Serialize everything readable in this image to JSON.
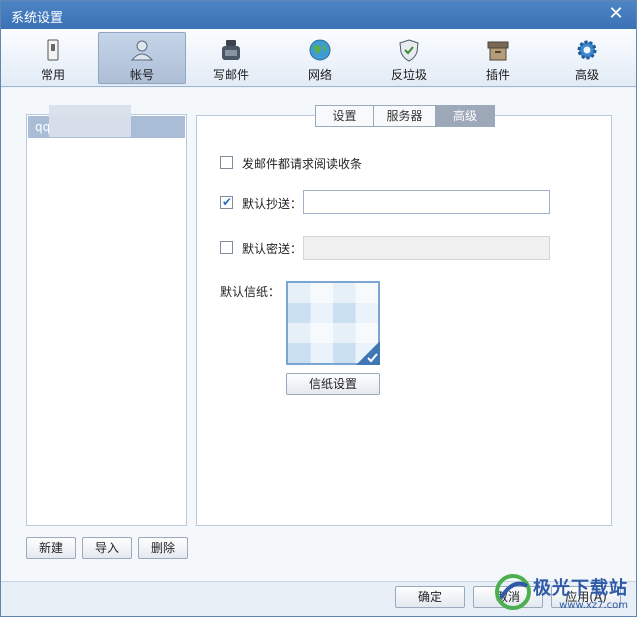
{
  "window": {
    "title": "系统设置"
  },
  "toolbar": {
    "items": [
      {
        "label": "常用",
        "icon": "phone-icon"
      },
      {
        "label": "帐号",
        "icon": "user-icon",
        "active": true
      },
      {
        "label": "写邮件",
        "icon": "ink-bottle-icon"
      },
      {
        "label": "网络",
        "icon": "globe-icon"
      },
      {
        "label": "反垃圾",
        "icon": "shield-icon"
      },
      {
        "label": "插件",
        "icon": "box-icon"
      },
      {
        "label": "高级",
        "icon": "gear-icon"
      }
    ]
  },
  "accounts": {
    "items": [
      {
        "label": "qq"
      }
    ],
    "new_label": "新建",
    "import_label": "导入",
    "delete_label": "删除"
  },
  "tabs": [
    {
      "label": "设置"
    },
    {
      "label": "服务器"
    },
    {
      "label": "高级",
      "selected": true
    }
  ],
  "advanced": {
    "read_receipt": {
      "label": "发邮件都请求阅读收条",
      "checked": false
    },
    "default_cc": {
      "label": "默认抄送：",
      "checked": true,
      "value": ""
    },
    "default_bcc": {
      "label": "默认密送：",
      "checked": false,
      "value": ""
    },
    "stationery_label": "默认信纸：",
    "stationery_button": "信纸设置"
  },
  "footer": {
    "ok_label": "确定",
    "cancel_label": "取消",
    "apply_label": "应用(A)"
  },
  "watermark": {
    "main": "极光下载站",
    "sub": "www.xz7.com"
  },
  "colors": {
    "titlebar": "#3d77bb",
    "tab_selected": "#9da9b8",
    "selection": "#a9bdd7",
    "accent": "#2c6fc4"
  }
}
